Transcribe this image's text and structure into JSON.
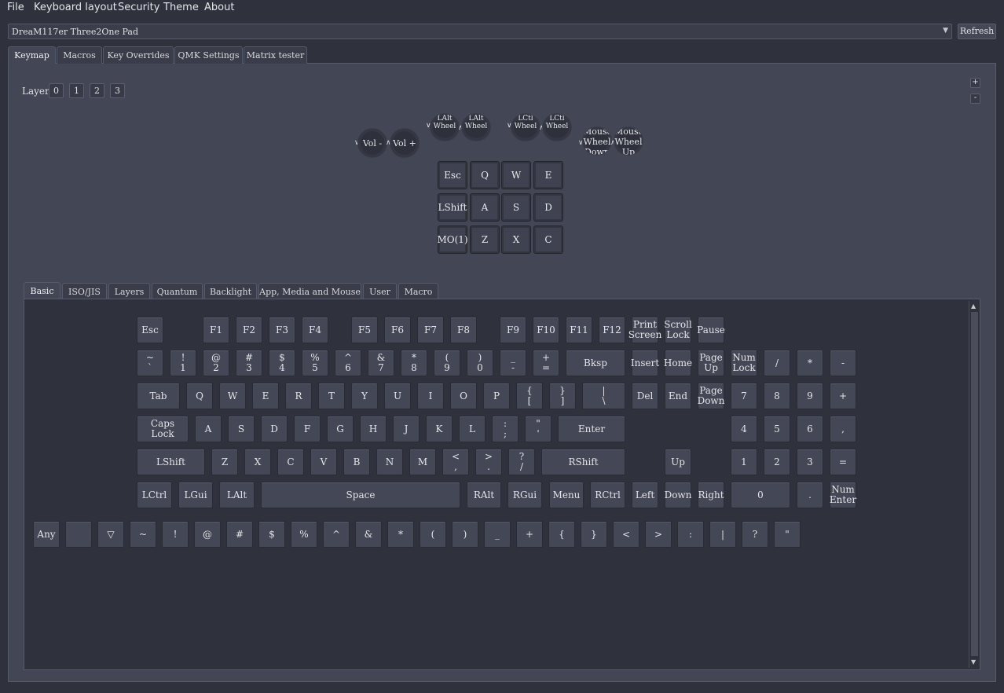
{
  "menu": [
    "File",
    "Keyboard layout",
    "Security",
    "Theme",
    "About"
  ],
  "device": {
    "selected": "DreaM117er Three2One Pad",
    "refresh_label": "Refresh"
  },
  "top_tabs": [
    "Keymap",
    "Macros",
    "Key Overrides",
    "QMK Settings",
    "Matrix tester"
  ],
  "layers": {
    "label": "Layer",
    "items": [
      "0",
      "1",
      "2",
      "3"
    ]
  },
  "zoom": {
    "plus": "+",
    "minus": "-"
  },
  "encoders": [
    {
      "label": "Vol -"
    },
    {
      "label": "Vol +"
    },
    {
      "label": "LAlt\nWheel"
    },
    {
      "label": "LAlt\nWheel"
    },
    {
      "label": "LCtl\nWheel"
    },
    {
      "label": "LCtl\nWheel"
    },
    {
      "label": "Mouse\nWheel\nDown"
    },
    {
      "label": "Mouse\nWheel\nUp"
    }
  ],
  "keymap": [
    [
      "Esc",
      "Q",
      "W",
      "E"
    ],
    [
      "LShift",
      "A",
      "S",
      "D"
    ],
    [
      "MO(1)",
      "Z",
      "X",
      "C"
    ]
  ],
  "bottom_tabs": [
    "Basic",
    "ISO/JIS",
    "Layers",
    "Quantum",
    "Backlight",
    "App, Media and Mouse",
    "User",
    "Macro"
  ],
  "basic_rows": {
    "r1": [
      "Esc",
      "F1",
      "F2",
      "F3",
      "F4",
      "F5",
      "F6",
      "F7",
      "F8",
      "F9",
      "F10",
      "F11",
      "F12",
      "Print\nScreen",
      "Scroll\nLock",
      "Pause"
    ],
    "r2": [
      "~\n`",
      "!\n1",
      "@\n2",
      "#\n3",
      "$\n4",
      "%\n5",
      "^\n6",
      "&\n7",
      "*\n8",
      "(\n9",
      ")\n0",
      "_\n-",
      "+\n=",
      "Bksp",
      "Insert",
      "Home",
      "Page\nUp",
      "Num\nLock",
      "/",
      "*",
      "-"
    ],
    "r3": [
      "Tab",
      "Q",
      "W",
      "E",
      "R",
      "T",
      "Y",
      "U",
      "I",
      "O",
      "P",
      "{\n[",
      "}\n]",
      "|\n\\",
      "Del",
      "End",
      "Page\nDown",
      "7",
      "8",
      "9",
      "+"
    ],
    "r4": [
      "Caps\nLock",
      "A",
      "S",
      "D",
      "F",
      "G",
      "H",
      "J",
      "K",
      "L",
      ":\n;",
      "\"\n'",
      "Enter",
      "4",
      "5",
      "6",
      ","
    ],
    "r5": [
      "LShift",
      "Z",
      "X",
      "C",
      "V",
      "B",
      "N",
      "M",
      "<\n,",
      ">\n.",
      "?\n/",
      "RShift",
      "Up",
      "1",
      "2",
      "3",
      "="
    ],
    "r6": [
      "LCtrl",
      "LGui",
      "LAlt",
      "Space",
      "RAlt",
      "RGui",
      "Menu",
      "RCtrl",
      "Left",
      "Down",
      "Right",
      "0",
      ".",
      "Num\nEnter"
    ],
    "r7": [
      "Any",
      "",
      "▽",
      "~",
      "!",
      "@",
      "#",
      "$",
      "%",
      "^",
      "&",
      "*",
      "(",
      ")",
      "_",
      "+",
      "{",
      "}",
      "<",
      ">",
      ":",
      "|",
      "?",
      "\""
    ]
  }
}
